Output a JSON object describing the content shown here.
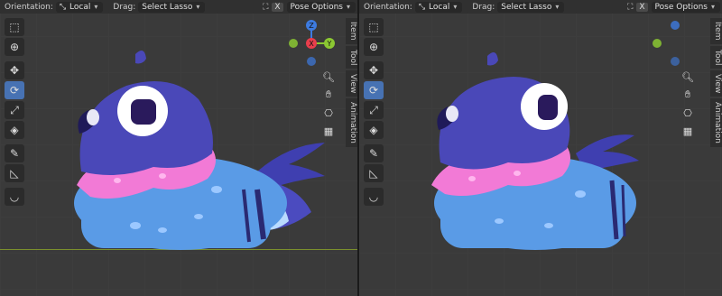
{
  "header": {
    "orientation_label": "Orientation:",
    "orientation_value": "Local",
    "drag_label": "Drag:",
    "drag_value": "Select Lasso",
    "x_label": "X",
    "pose_options": "Pose Options"
  },
  "tabs": [
    "Item",
    "Tool",
    "View",
    "Animation"
  ],
  "gizmo": {
    "z": "Z",
    "x": "X",
    "y": "Y"
  },
  "colors": {
    "accent": "#4772b3",
    "gizmo_x": "#e83e4c",
    "gizmo_y": "#8bc832",
    "gizmo_z": "#3d7be0",
    "bird_head": "#4a48b8",
    "bird_body": "#5a9be6",
    "bird_ruff": "#f27ad6"
  },
  "icons": [
    "select-box-icon",
    "cursor-icon",
    "move-icon",
    "rotate-icon",
    "scale-icon",
    "transform-icon",
    "annotate-icon",
    "measure-icon",
    "relax-icon",
    "zoom-icon",
    "hand-icon",
    "camera-icon",
    "grid-icon"
  ]
}
